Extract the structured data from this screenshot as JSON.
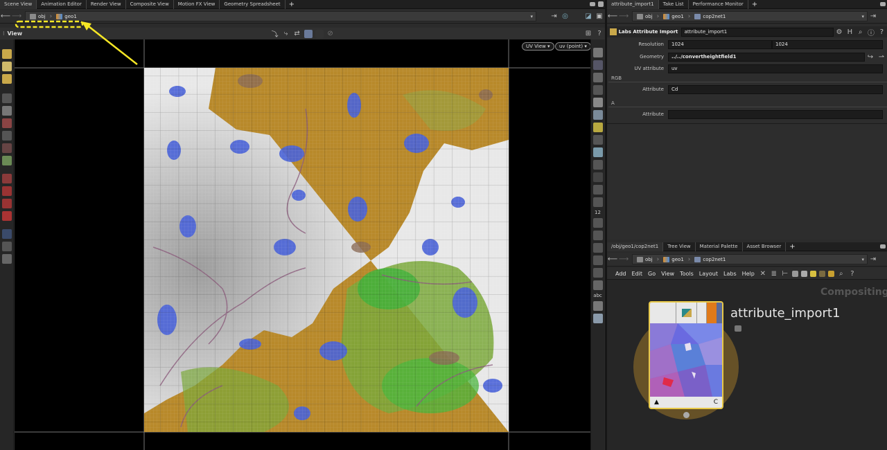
{
  "left_tabs": [
    "Scene View",
    "Animation Editor",
    "Render View",
    "Composite View",
    "Motion FX View",
    "Geometry Spreadsheet"
  ],
  "right_top_tabs": [
    "attribute_import1",
    "Take List",
    "Performance Monitor"
  ],
  "right_bottom_tabs": [
    "/obj/geo1/cop2net1",
    "Tree View",
    "Material Palette",
    "Asset Browser"
  ],
  "plus": "+",
  "left_path": {
    "obj": "obj",
    "geo": "geo1"
  },
  "right_path": {
    "obj": "obj",
    "geo": "geo1",
    "net": "cop2net1"
  },
  "viewport": {
    "label": "View",
    "uv_view": "UV View ▾",
    "uv_point": "uv (point) ▾"
  },
  "rightbar_labels": {
    "n12": "12",
    "abc": "abc"
  },
  "params": {
    "node_type": "Labs Attribute Import",
    "node_name": "attribute_import1",
    "resolution_label": "Resolution",
    "res_x": "1024",
    "res_y": "1024",
    "geometry_label": "Geometry",
    "geometry_value": "../../convertheightfield1",
    "uv_label": "UV attribute",
    "uv_value": "uv",
    "rgb_section": "RGB",
    "rgb_attr_label": "Attribute",
    "rgb_attr_value": "Cd",
    "a_section": "A",
    "a_attr_label": "Attribute",
    "a_attr_value": ""
  },
  "menus": [
    "Add",
    "Edit",
    "Go",
    "View",
    "Tools",
    "Layout",
    "Labs",
    "Help"
  ],
  "network": {
    "context_label": "Compositing",
    "node_label": "attribute_import1",
    "flag_left": "▲",
    "flag_right": "C"
  },
  "colors": {
    "annotation": "#f5e625",
    "node_border": "#e8c948",
    "node_glow": "#8a6a30"
  }
}
